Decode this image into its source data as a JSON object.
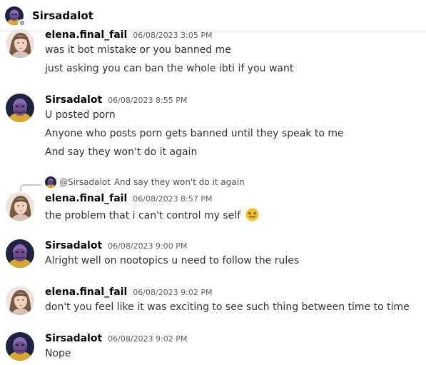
{
  "header": {
    "title": "Sirsadalot"
  },
  "messages": [
    {
      "author": "elena.final_fail",
      "time": "06/08/2023 3:05 PM",
      "lines": [
        "was it bot mistake or you banned me",
        "just asking you can ban the whole ibti if you want"
      ]
    },
    {
      "author": "Sirsadalot",
      "time": "06/08/2023 8:55 PM",
      "lines": [
        "U posted porn",
        "Anyone who posts porn gets banned until they speak to me",
        "And say they won't do it again"
      ]
    },
    {
      "author": "elena.final_fail",
      "time": "06/08/2023 8:57 PM",
      "reply": {
        "mention": "@Sirsadalot",
        "text": "And say they won't do it again"
      },
      "lines": [
        "the problem that i can't control my self"
      ],
      "emoji": "confounded-face"
    },
    {
      "author": "Sirsadalot",
      "time": "06/08/2023 9:00 PM",
      "lines": [
        "Alright well on nootopics u need to follow the rules"
      ]
    },
    {
      "author": "elena.final_fail",
      "time": "06/08/2023 9:02 PM",
      "lines": [
        "don't you feel like it was exciting to see such thing between time to time"
      ]
    },
    {
      "author": "Sirsadalot",
      "time": "06/08/2023 9:02 PM",
      "lines": [
        "Nope"
      ]
    }
  ],
  "colors": {
    "status": "#80848e",
    "emoji": "#f5c02c"
  }
}
